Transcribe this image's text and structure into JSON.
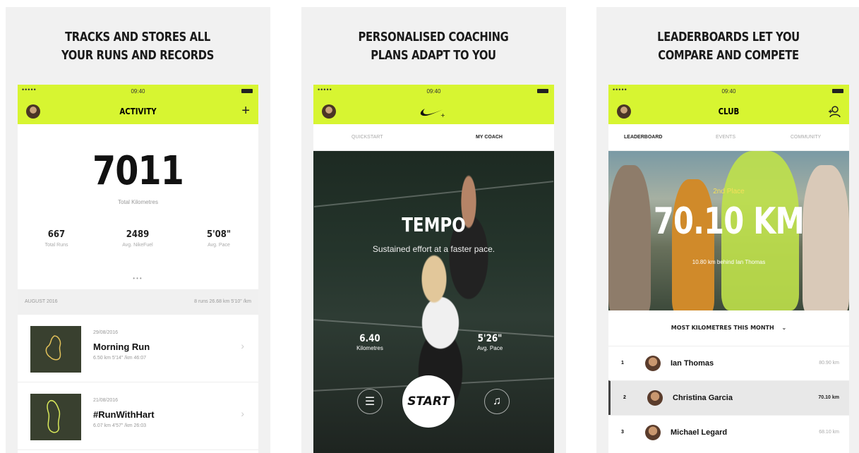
{
  "panels": [
    {
      "headline": "TRACKS AND STORES ALL YOUR RUNS AND RECORDS",
      "status": {
        "signal": "•••••",
        "time": "09:40"
      },
      "nav": {
        "title": "ACTIVITY",
        "action": "+"
      },
      "total": {
        "value": "7011",
        "label": "Total Kilometres"
      },
      "stats": [
        {
          "value": "667",
          "label": "Total Runs"
        },
        {
          "value": "2489",
          "label": "Avg. NikeFuel"
        },
        {
          "value": "5'08\"",
          "label": "Avg. Pace"
        }
      ],
      "pager": "•••",
      "month": {
        "label": "AUGUST 2016",
        "summary": "8 runs   26.68 km   5'10\" /km"
      },
      "runs": [
        {
          "date": "29/08/2016",
          "name": "Morning Run",
          "meta": "6.50 km    5'14\" /km    46:07"
        },
        {
          "date": "21/08/2016",
          "name": "#RunWithHart",
          "meta": "6.07 km    4'57\" /km    26:03"
        }
      ]
    },
    {
      "headline": "PERSONALISED COACHING PLANS ADAPT TO YOU",
      "status": {
        "signal": "•••••",
        "time": "09:40"
      },
      "tabs": [
        "QUICKSTART",
        "MY COACH"
      ],
      "workout": {
        "title": "TEMPO",
        "description": "Sustained effort at a faster pace."
      },
      "stats": [
        {
          "value": "6.40",
          "label": "Kilometres"
        },
        {
          "value": "5'26\"",
          "label": "Avg. Pace"
        }
      ],
      "start_label": "START"
    },
    {
      "headline": "LEADERBOARDS LET YOU COMPARE AND COMPETE",
      "status": {
        "signal": "•••••",
        "time": "09:40"
      },
      "nav": {
        "title": "CLUB"
      },
      "tabs": [
        "LEADERBOARD",
        "EVENTS",
        "COMMUNITY"
      ],
      "hero": {
        "rank": "2nd Place",
        "distance": "70.10 KM",
        "behind": "10.80 km behind Ian Thomas"
      },
      "filter": "MOST KILOMETRES THIS MONTH",
      "leaderboard": [
        {
          "rank": "1",
          "name": "Ian Thomas",
          "distance": "80.90 km"
        },
        {
          "rank": "2",
          "name": "Christina Garcia",
          "distance": "70.10 km"
        },
        {
          "rank": "3",
          "name": "Michael Legard",
          "distance": "68.10 km"
        }
      ]
    }
  ]
}
